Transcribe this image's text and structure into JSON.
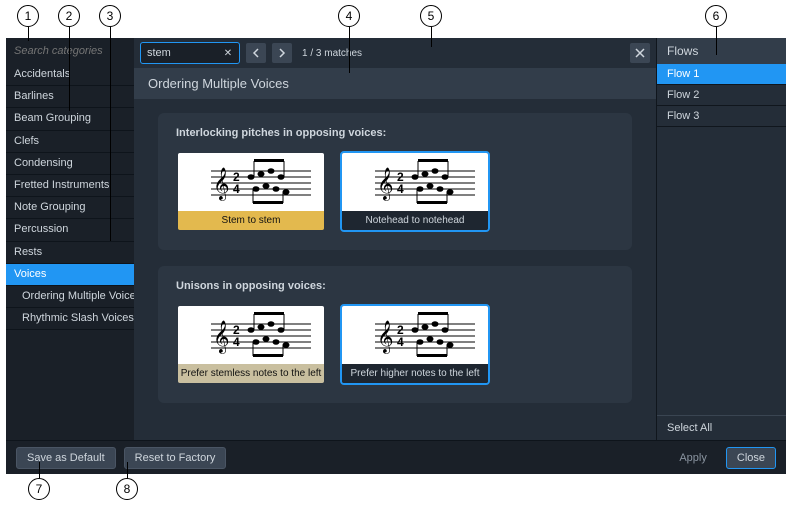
{
  "callouts": [
    "1",
    "2",
    "3",
    "4",
    "5",
    "6",
    "7",
    "8"
  ],
  "sidebar": {
    "search_placeholder": "Search categories",
    "items": [
      {
        "label": "Accidentals"
      },
      {
        "label": "Barlines"
      },
      {
        "label": "Beam Grouping"
      },
      {
        "label": "Clefs"
      },
      {
        "label": "Condensing"
      },
      {
        "label": "Fretted Instruments"
      },
      {
        "label": "Note Grouping"
      },
      {
        "label": "Percussion"
      },
      {
        "label": "Rests"
      },
      {
        "label": "Voices",
        "selected": true
      }
    ],
    "subitems": [
      {
        "label": "Ordering Multiple Voices"
      },
      {
        "label": "Rhythmic Slash Voices"
      }
    ]
  },
  "search": {
    "value": "stem",
    "match_count": "1 / 3 matches"
  },
  "section": {
    "title": "Ordering Multiple Voices"
  },
  "groups": [
    {
      "title": "Interlocking pitches in opposing voices:",
      "options": [
        {
          "label": "Stem to stem",
          "highlight": "yellow"
        },
        {
          "label": "Notehead to notehead",
          "selected": true
        }
      ]
    },
    {
      "title": "Unisons in opposing voices:",
      "options": [
        {
          "label": "Prefer stemless notes to the left",
          "highlight": "beige"
        },
        {
          "label": "Prefer higher notes to the left",
          "selected": true
        }
      ]
    }
  ],
  "flows": {
    "header": "Flows",
    "items": [
      {
        "label": "Flow 1",
        "selected": true
      },
      {
        "label": "Flow 2"
      },
      {
        "label": "Flow 3"
      }
    ],
    "select_all": "Select All"
  },
  "footer": {
    "save_default": "Save as Default",
    "reset_factory": "Reset to Factory",
    "apply": "Apply",
    "close": "Close"
  }
}
